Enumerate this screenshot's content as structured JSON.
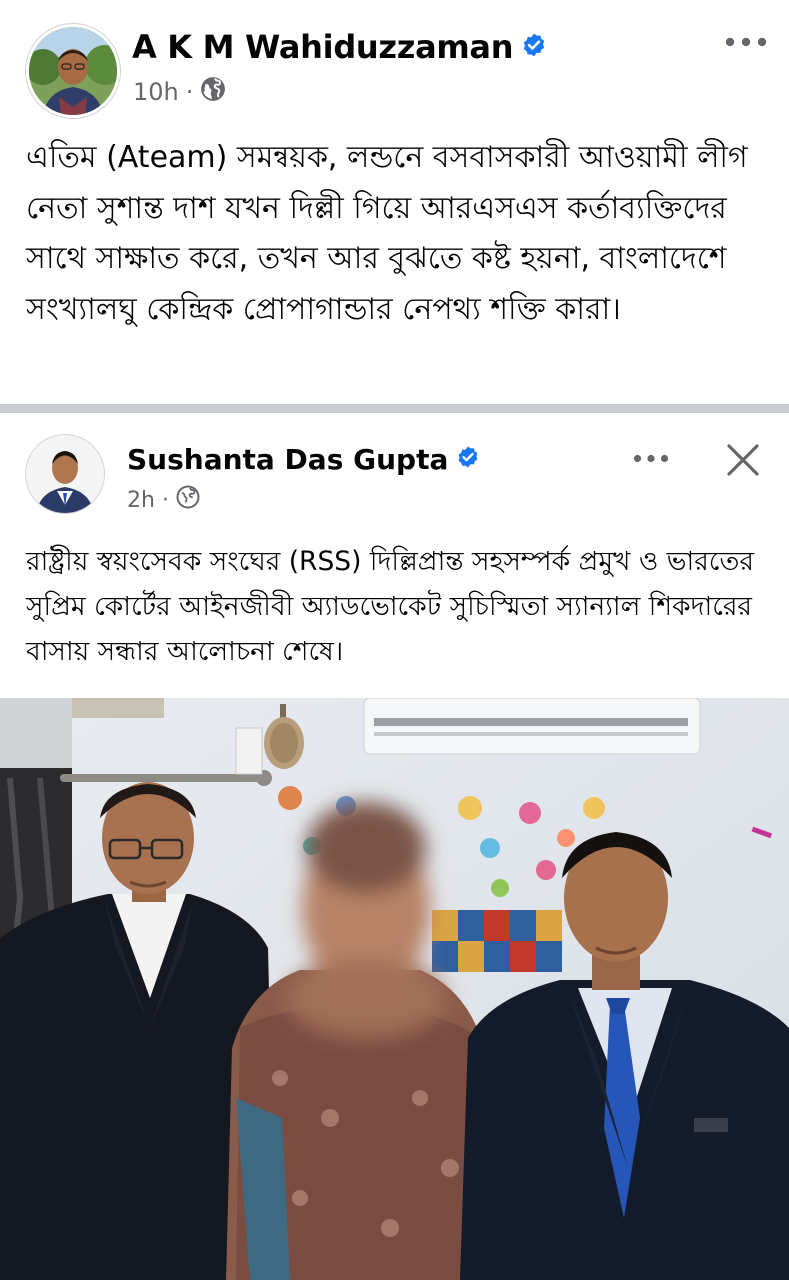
{
  "outer_post": {
    "author": "A K M Wahiduzzaman",
    "verified": true,
    "time": "10h",
    "separator": "·",
    "audience_icon": "globe-icon",
    "more_icon": "more-options-icon",
    "text": "এতিম (Ateam) সমন্বয়ক, লন্ডনে বসবাসকারী আওয়ামী লীগ নেতা সুশান্ত দাশ যখন দিল্লী গিয়ে আরএসএস কর্তাব্যক্তিদের  সাথে সাক্ষাত করে, তখন আর বুঝতে কষ্ট হয়না, বাংলাদেশে সংখ্যালঘু কেন্দ্রিক প্রোপাগান্ডার নেপথ্য শক্তি কারা।"
  },
  "shared_post": {
    "author": "Sushanta Das Gupta",
    "verified": true,
    "time": "2h",
    "separator": "·",
    "audience_icon": "globe-icon",
    "more_icon": "more-options-icon",
    "close_icon": "close-icon",
    "text": "রাষ্ট্রীয় স্বয়ংসেবক সংঘের (RSS) দিল্লিপ্রান্ত সহসম্পর্ক প্রমুখ ও ভারতের সুপ্রিম কোর্টের আইনজীবী অ্যাডভোকেট সুচিস্মিতা স্যান্যাল শিকদারের বাসায় সন্ধার আলোচনা শেষে।"
  },
  "colors": {
    "verified_blue": "#1877f2",
    "meta_gray": "#65676b",
    "divider": "#c9ccd1",
    "text": "#050505"
  }
}
